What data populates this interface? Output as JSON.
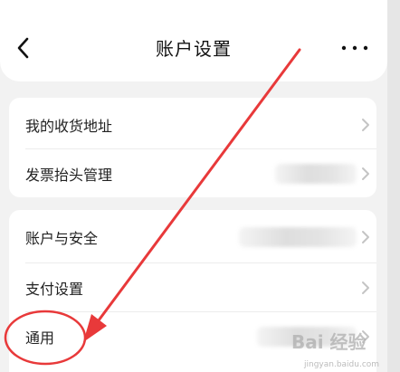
{
  "header": {
    "title": "账户设置",
    "back_icon": "chevron-left-icon",
    "more_icon": "more-dots-icon"
  },
  "group1": [
    {
      "label": "我的收货地址"
    },
    {
      "label": "发票抬头管理"
    }
  ],
  "group2": [
    {
      "label": "账户与安全"
    },
    {
      "label": "支付设置"
    },
    {
      "label": "通用"
    }
  ],
  "annotation": {
    "color": "#e8393a"
  },
  "watermark": {
    "text": "Bai 经验",
    "sub": "jingyan.baidu.com"
  }
}
